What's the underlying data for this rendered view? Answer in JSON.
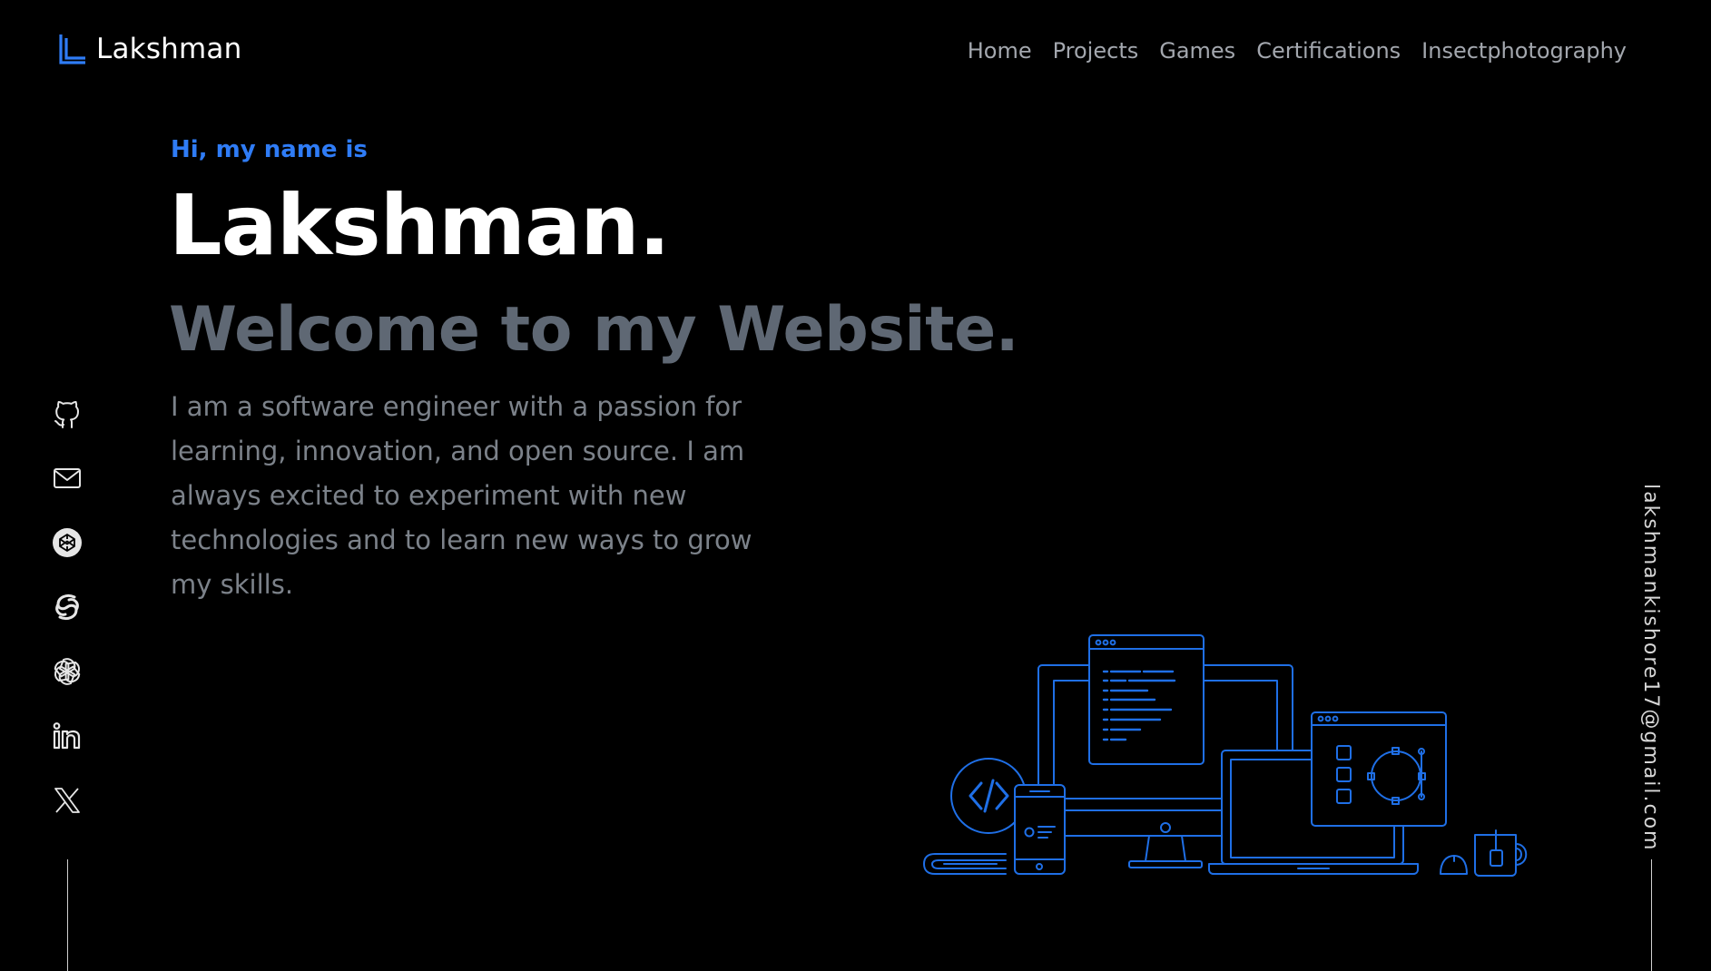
{
  "colors": {
    "background": "#000000",
    "accent": "#2f7cf6",
    "heading": "#ffffff",
    "subheading": "#5f6874",
    "body_text": "#7c828a",
    "nav_text": "#a3a7ae"
  },
  "header": {
    "logo_icon": "L-logo-icon",
    "logo_text": "Lakshman",
    "nav": [
      {
        "label": "Home"
      },
      {
        "label": "Projects"
      },
      {
        "label": "Games"
      },
      {
        "label": "Certifications"
      },
      {
        "label": "Insectphotography"
      }
    ]
  },
  "hero": {
    "intro": "Hi, my name is",
    "name": "Lakshman.",
    "subtitle": "Welcome to my Website.",
    "description": "I am a software engineer with a passion for learning, innovation, and open source. I am always excited to experiment with new technologies and to learn new ways to grow my skills."
  },
  "socials": [
    {
      "icon": "github-icon"
    },
    {
      "icon": "mail-icon"
    },
    {
      "icon": "codepen-icon"
    },
    {
      "icon": "sololearn-icon"
    },
    {
      "icon": "openai-icon"
    },
    {
      "icon": "linkedin-icon"
    },
    {
      "icon": "x-icon"
    }
  ],
  "side_email": "lakshmankishore17@gmail.com",
  "illustration": {
    "icon": "developer-devices-illustration"
  }
}
